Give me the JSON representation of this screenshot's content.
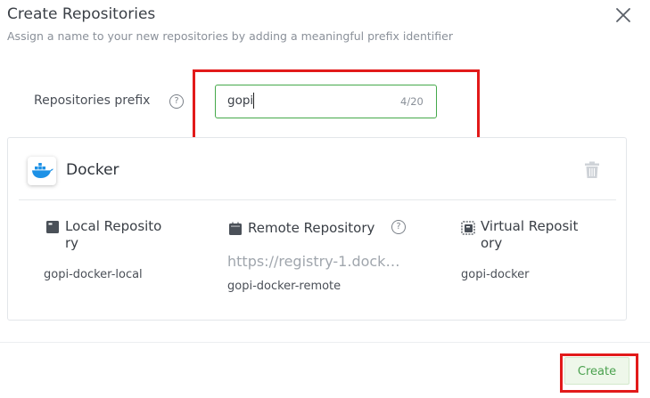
{
  "dialog": {
    "title": "Create Repositories",
    "subtitle": "Assign a name to your new repositories by adding a meaningful prefix identifier"
  },
  "prefix": {
    "label": "Repositories prefix",
    "help": "?",
    "value": "gopi",
    "counter": "4/20"
  },
  "package": {
    "icon": "docker-icon",
    "name": "Docker",
    "local": {
      "icon": "local-repo-icon",
      "title_line1": "Local Reposito",
      "title_line2": "ry",
      "name": "gopi-docker-local"
    },
    "remote": {
      "icon": "remote-repo-icon",
      "title": "Remote Repository",
      "help": "?",
      "url": "https://registry-1.dock…",
      "name": "gopi-docker-remote"
    },
    "virtual": {
      "icon": "virtual-repo-icon",
      "title_line1": "Virtual Reposit",
      "title_line2": "ory",
      "name": "gopi-docker"
    }
  },
  "footer": {
    "create_label": "Create"
  },
  "colors": {
    "accent_green": "#45a94a",
    "highlight_red": "#e21a1a",
    "docker_blue": "#1d91e6"
  }
}
